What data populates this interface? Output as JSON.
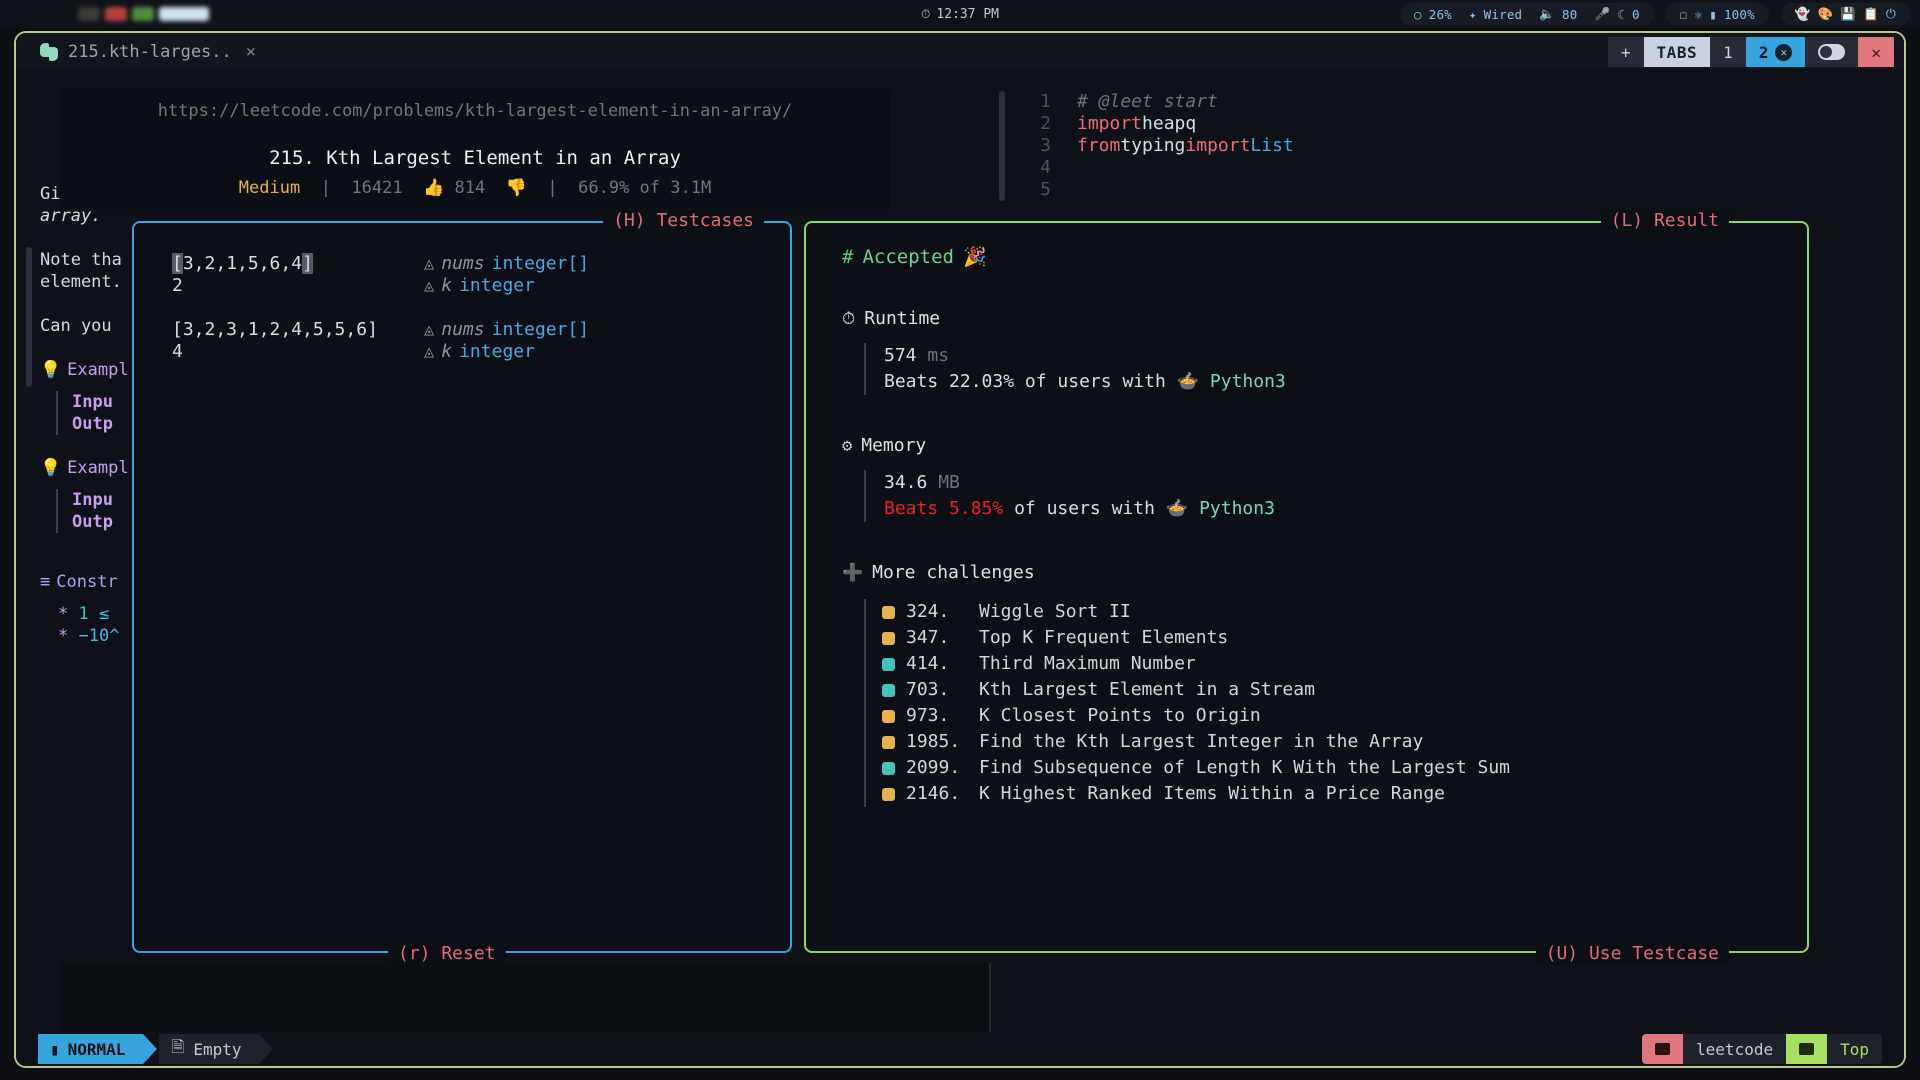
{
  "osbar": {
    "clock": "12:37 PM",
    "clock_icon": "clock-icon",
    "status_group_1": {
      "cpu": "26%",
      "network": "Wired",
      "volume": "80",
      "moon": "0"
    },
    "status_group_2": {
      "battery": "100%"
    },
    "tray_icons": [
      "ghost-icon",
      "palette-icon",
      "save-icon",
      "copy-icon",
      "power-icon"
    ]
  },
  "tabbar": {
    "tab_title": "215.kth-larges..",
    "tab_close": "×",
    "controls": {
      "new": "+",
      "tabs_label": "TABS",
      "tab1": "1",
      "tab2": "2",
      "tab2_close": "✕",
      "window_close": "✕"
    }
  },
  "problem": {
    "url": "https://leetcode.com/problems/kth-largest-element-in-an-array/",
    "title": "215. Kth Largest Element in an Array",
    "difficulty": "Medium",
    "likes": "16421",
    "dislikes": "814",
    "acceptance": "66.9% of 3.1M"
  },
  "description": {
    "paragraphs": [
      "Given an",
      "array.",
      "Note tha",
      "element.",
      "Can you"
    ],
    "examples": [
      {
        "heading": "Exampl",
        "lines": [
          "Inpu",
          "Outp"
        ]
      },
      {
        "heading": "Exampl",
        "lines": [
          "Inpu",
          "Outp"
        ]
      }
    ],
    "constraints_heading": "Constr",
    "constraints": [
      "1  ≤",
      "−10^"
    ]
  },
  "editor": {
    "lines": [
      {
        "no": "1",
        "tokens": [
          {
            "t": "# @leet start",
            "c": "cmt"
          }
        ]
      },
      {
        "no": "2",
        "tokens": [
          {
            "t": "import",
            "c": "kw"
          },
          {
            "t": " heapq",
            "c": "id"
          }
        ]
      },
      {
        "no": "3",
        "tokens": [
          {
            "t": "from",
            "c": "kw"
          },
          {
            "t": " typing ",
            "c": "id"
          },
          {
            "t": "import",
            "c": "kw"
          },
          {
            "t": " ",
            "c": "id"
          },
          {
            "t": "List",
            "c": "ty"
          }
        ]
      },
      {
        "no": "4",
        "tokens": []
      },
      {
        "no": "5",
        "tokens": []
      }
    ]
  },
  "testcases_panel": {
    "title": "(H) Testcases",
    "footer": "(r) Reset",
    "cases": [
      {
        "nums_value": "[3,2,1,5,6,4]",
        "nums_name": "nums",
        "nums_type": "integer[]",
        "k_value": "2",
        "k_name": "k",
        "k_type": "integer"
      },
      {
        "nums_value": "[3,2,3,1,2,4,5,5,6]",
        "nums_name": "nums",
        "nums_type": "integer[]",
        "k_value": "4",
        "k_name": "k",
        "k_type": "integer"
      }
    ]
  },
  "result_panel": {
    "title": "(L) Result",
    "footer": "(U) Use Testcase",
    "verdict": "Accepted",
    "verdict_emoji": "🎉",
    "runtime": {
      "heading": "Runtime",
      "value": "574",
      "unit": "ms",
      "beats_prefix": "Beats",
      "beats_pct": "22.03%",
      "beats_suffix": "of users with",
      "language": "Python3"
    },
    "memory": {
      "heading": "Memory",
      "value": "34.6",
      "unit": "MB",
      "beats_prefix": "Beats",
      "beats_pct": "5.85%",
      "beats_suffix": "of users with",
      "language": "Python3"
    },
    "challenges_heading": "More challenges",
    "challenges": [
      {
        "id": "324.",
        "name": "Wiggle Sort II",
        "difficulty": "Medium"
      },
      {
        "id": "347.",
        "name": "Top K Frequent Elements",
        "difficulty": "Medium"
      },
      {
        "id": "414.",
        "name": "Third Maximum Number",
        "difficulty": "Easy"
      },
      {
        "id": "703.",
        "name": "Kth Largest Element in a Stream",
        "difficulty": "Easy"
      },
      {
        "id": "973.",
        "name": "K Closest Points to Origin",
        "difficulty": "Medium"
      },
      {
        "id": "1985.",
        "name": "Find the Kth Largest Integer in the Array",
        "difficulty": "Medium"
      },
      {
        "id": "2099.",
        "name": "Find Subsequence of Length K With the Largest Sum",
        "difficulty": "Easy"
      },
      {
        "id": "2146.",
        "name": "K Highest Ranked Items Within a Price Range",
        "difficulty": "Medium"
      }
    ]
  },
  "statusline": {
    "mode": "NORMAL",
    "buffer": "Empty",
    "project": "leetcode",
    "scroll_position": "Top"
  },
  "colors": {
    "accent_blue": "#36a5dd",
    "accent_green": "#8fd66a",
    "label_red": "#e06c75",
    "difficulty_medium": "#e6b34c",
    "difficulty_easy": "#45c2b8",
    "bad_red": "#f02020",
    "window_border": "#b5c98c"
  }
}
